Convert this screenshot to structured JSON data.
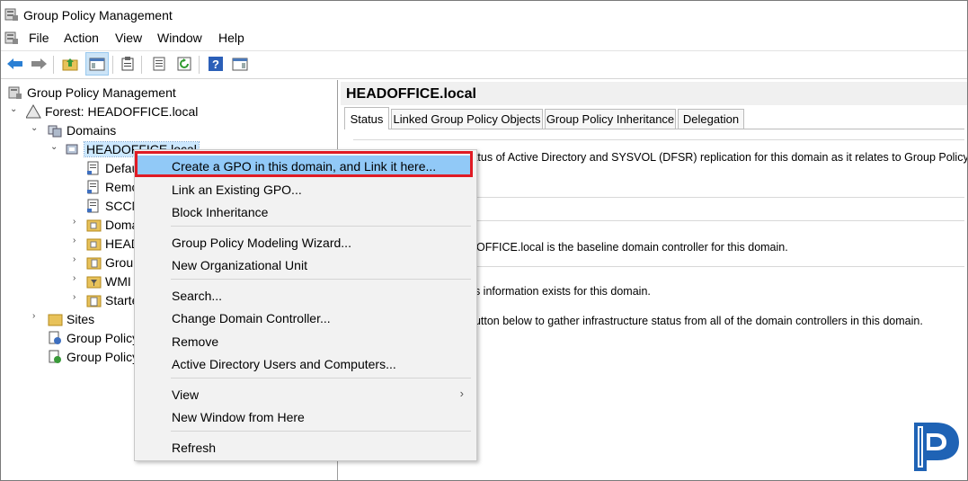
{
  "window": {
    "title": "Group Policy Management"
  },
  "menu": [
    "File",
    "Action",
    "View",
    "Window",
    "Help"
  ],
  "toolbar": {
    "icons": [
      "back-arrow-icon",
      "forward-arrow-icon",
      "up-folder-icon",
      "show-hide-console-tree-icon",
      "properties-icon",
      "export-list-icon",
      "refresh-icon",
      "help-icon",
      "show-action-pane-icon"
    ]
  },
  "tree": {
    "root": "Group Policy Management",
    "forest": "Forest: HEADOFFICE.local",
    "domains": "Domains",
    "domain": "HEADOFFICE.local",
    "children": [
      "Defau",
      "Remo",
      "SCCM",
      "Doma",
      "HEAD",
      "Grou",
      "WMI",
      "Starte"
    ],
    "sites": "Sites",
    "modeling": "Group Policy",
    "results": "Group Policy"
  },
  "right": {
    "title": "HEADOFFICE.local",
    "tabs": [
      "Status",
      "Linked Group Policy Objects",
      "Group Policy Inheritance",
      "Delegation"
    ],
    "lines": [
      "tatus of Active Directory and SYSVOL (DFSR) replication for this domain as it relates to Group Policy.",
      "DOFFICE.local is the baseline domain controller for this domain.",
      "us information exists for this domain.",
      "button below to gather infrastructure status from all of the domain controllers in this domain."
    ]
  },
  "context_menu": {
    "items": [
      "Create a GPO in this domain, and Link it here...",
      "Link an Existing GPO...",
      "Block Inheritance",
      "Group Policy Modeling Wizard...",
      "New Organizational Unit",
      "Search...",
      "Change Domain Controller...",
      "Remove",
      "Active Directory Users and Computers...",
      "View",
      "New Window from Here",
      "Refresh"
    ],
    "submenu_arrow": "›"
  },
  "colors": {
    "highlight": "#91c9f7",
    "callout": "#e01b24",
    "logo": "#1f63b5"
  }
}
